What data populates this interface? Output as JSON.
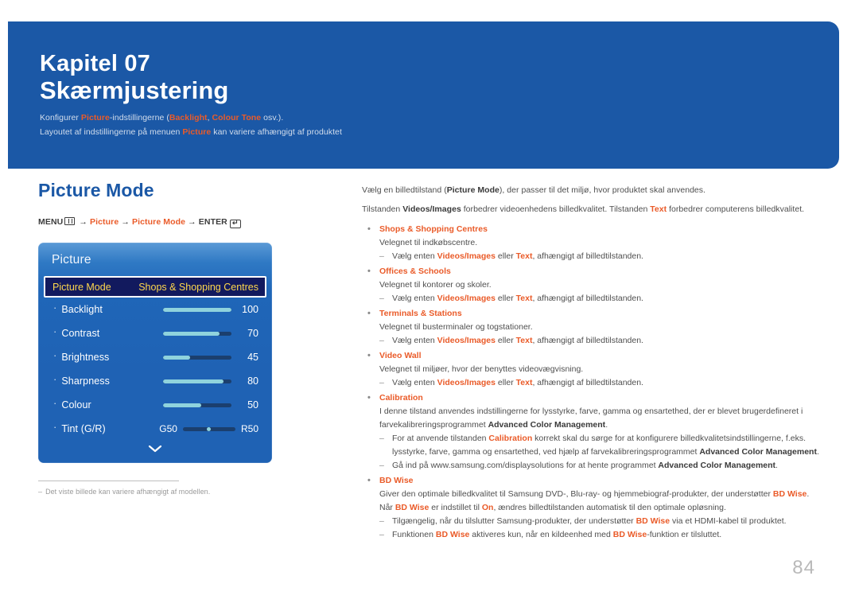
{
  "banner": {
    "kicker": "Kapitel 07",
    "title": "Skærmjustering",
    "note_line1_a": "Konfigurer ",
    "note_line1_hl1": "Picture",
    "note_line1_b": "-indstillingerne (",
    "note_line1_hl2": "Backlight",
    "note_line1_c": ", ",
    "note_line1_hl3": "Colour Tone",
    "note_line1_d": " osv.).",
    "note_line2_a": "Layoutet af indstillingerne på menuen ",
    "note_line2_hl1": "Picture",
    "note_line2_b": " kan variere afhængigt af produktet"
  },
  "left": {
    "section_title": "Picture Mode",
    "menu_path": {
      "menu_label": "MENU",
      "menu_icon": "menu-grid-icon",
      "arrow": "→",
      "step1": "Picture",
      "step2": "Picture Mode",
      "enter_label": "ENTER",
      "enter_icon": "enter-key-icon",
      "enter_glyph": "↵"
    },
    "osd": {
      "title": "Picture",
      "selected": {
        "label": "Picture Mode",
        "value": "Shops & Shopping Centres"
      },
      "rows": [
        {
          "label": "Backlight",
          "value": "100",
          "fill_pct": 100
        },
        {
          "label": "Contrast",
          "value": "70",
          "fill_pct": 82
        },
        {
          "label": "Brightness",
          "value": "45",
          "fill_pct": 40
        },
        {
          "label": "Sharpness",
          "value": "80",
          "fill_pct": 88
        },
        {
          "label": "Colour",
          "value": "50",
          "fill_pct": 56
        }
      ],
      "tint_row": {
        "label": "Tint (G/R)",
        "left_end": "G50",
        "right_end": "R50"
      },
      "more_icon": "chevron-down-icon"
    },
    "footnote": {
      "dash": "‒",
      "text": "Det viste billede kan variere afhængigt af modellen."
    }
  },
  "right": {
    "lead1": {
      "a": "Vælg en billedtilstand (",
      "b1": "Picture Mode",
      "b": "), der passer til det miljø, hvor produktet skal anvendes."
    },
    "lead2": {
      "a": "Tilstanden ",
      "b1": "Videos/Images",
      "b": " forbedrer videoenhedens billedkvalitet. Tilstanden ",
      "b2": "Text",
      "c": " forbedrer computerens billedkvalitet."
    },
    "common_sub": {
      "a": "Vælg enten ",
      "b1": "Videos/Images",
      "b": " eller ",
      "b2": "Text",
      "c": ", afhængigt af billedtilstanden."
    },
    "blocks": [
      {
        "head": "Shops & Shopping Centres",
        "body": "Velegnet til indkøbscentre."
      },
      {
        "head": "Offices & Schools",
        "body": "Velegnet til kontorer og skoler."
      },
      {
        "head": "Terminals & Stations",
        "body": "Velegnet til busterminaler og togstationer."
      },
      {
        "head": "Video Wall",
        "body": "Velegnet til miljøer, hvor der benyttes videovægvisning."
      }
    ],
    "calibration": {
      "head": "Calibration",
      "body_a": "I denne tilstand anvendes indstillingerne for lysstyrke, farve, gamma og ensartethed, der er blevet brugerdefineret i farvekalibreringsprogrammet ",
      "body_b": "Advanced Color Management",
      "body_c": ".",
      "sub1_a": "For at anvende tilstanden ",
      "sub1_o": "Calibration",
      "sub1_b": " korrekt skal du sørge for at konfigurere billedkvalitetsindstillingerne, f.eks. lysstyrke, farve, gamma og ensartethed, ved hjælp af farvekalibreringsprogrammet ",
      "sub1_bold": "Advanced Color Management",
      "sub1_c": ".",
      "sub2_a": "Gå ind på www.samsung.com/displaysolutions for at hente programmet ",
      "sub2_bold": "Advanced Color Management",
      "sub2_c": "."
    },
    "bdwise": {
      "head": "BD Wise",
      "body_a": "Giver den optimale billedkvalitet til Samsung DVD-, Blu-ray- og hjemmebiograf-produkter, der understøtter ",
      "body_o1": "BD Wise",
      "body_b": ". Når ",
      "body_o2": "BD Wise",
      "body_c": " er indstillet til ",
      "body_o3": "On",
      "body_d": ", ændres billedtilstanden automatisk til den optimale opløsning.",
      "sub1_a": "Tilgængelig, når du tilslutter Samsung-produkter, der understøtter ",
      "sub1_o": "BD Wise",
      "sub1_b": " via et HDMI-kabel til produktet.",
      "sub2_a": "Funktionen ",
      "sub2_o1": "BD Wise",
      "sub2_b": " aktiveres kun, når en kildeenhed med ",
      "sub2_o2": "BD Wise",
      "sub2_c": "-funktion er tilsluttet."
    }
  },
  "page_number": "84",
  "colors": {
    "brand_blue": "#1b58a6",
    "accent_orange": "#ea5b29",
    "osd_blue": "#1f62b4",
    "osd_selected_bg": "#121a5e",
    "osd_selected_text": "#ffd84d",
    "slider_fill": "#8fd3dd",
    "page_number_grey": "#b9b9b9"
  }
}
